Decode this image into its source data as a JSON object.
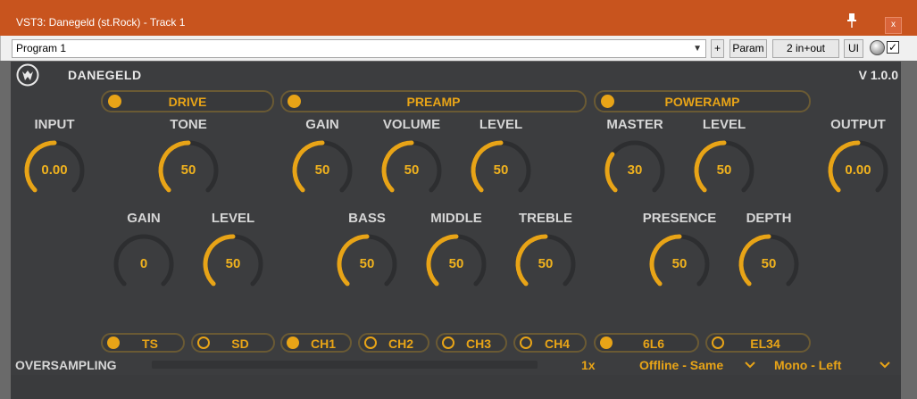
{
  "window": {
    "title": "VST3: Danegeld (st.Rock) - Track 1",
    "close_label": "x"
  },
  "toolbar": {
    "program": "Program 1",
    "plus_label": "+",
    "param_label": "Param",
    "io_label": "2 in+out",
    "ui_label": "UI",
    "bypass_checked": "✓"
  },
  "plugin": {
    "name": "DANEGELD",
    "version": "V 1.0.0",
    "accent_color": "#e8a417",
    "sections": {
      "drive": "DRIVE",
      "preamp": "PREAMP",
      "poweramp": "POWERAMP"
    },
    "knobs": {
      "input": {
        "label": "INPUT",
        "value": "0.00",
        "level": 0.5
      },
      "tone": {
        "label": "TONE",
        "value": "50",
        "level": 0.5
      },
      "pre_gain": {
        "label": "GAIN",
        "value": "50",
        "level": 0.5
      },
      "volume": {
        "label": "VOLUME",
        "value": "50",
        "level": 0.5
      },
      "pre_level": {
        "label": "LEVEL",
        "value": "50",
        "level": 0.5
      },
      "master": {
        "label": "MASTER",
        "value": "30",
        "level": 0.3
      },
      "pow_level": {
        "label": "LEVEL",
        "value": "50",
        "level": 0.5
      },
      "output": {
        "label": "OUTPUT",
        "value": "0.00",
        "level": 0.5
      },
      "drv_gain": {
        "label": "GAIN",
        "value": "0",
        "level": 0.0
      },
      "drv_level": {
        "label": "LEVEL",
        "value": "50",
        "level": 0.5
      },
      "bass": {
        "label": "BASS",
        "value": "50",
        "level": 0.5
      },
      "middle": {
        "label": "MIDDLE",
        "value": "50",
        "level": 0.5
      },
      "treble": {
        "label": "TREBLE",
        "value": "50",
        "level": 0.5
      },
      "presence": {
        "label": "PRESENCE",
        "value": "50",
        "level": 0.5
      },
      "depth": {
        "label": "DEPTH",
        "value": "50",
        "level": 0.5
      }
    },
    "toggles": {
      "ts": {
        "label": "TS",
        "on": true
      },
      "sd": {
        "label": "SD",
        "on": false
      },
      "ch1": {
        "label": "CH1",
        "on": true
      },
      "ch2": {
        "label": "CH2",
        "on": false
      },
      "ch3": {
        "label": "CH3",
        "on": false
      },
      "ch4": {
        "label": "CH4",
        "on": false
      },
      "l6": {
        "label": "6L6",
        "on": true
      },
      "el34": {
        "label": "EL34",
        "on": false
      }
    },
    "footer": {
      "oversampling_label": "OVERSAMPLING",
      "oversampling_value": "1x",
      "render_mode": "Offline - Same",
      "channel_mode": "Mono - Left"
    }
  }
}
